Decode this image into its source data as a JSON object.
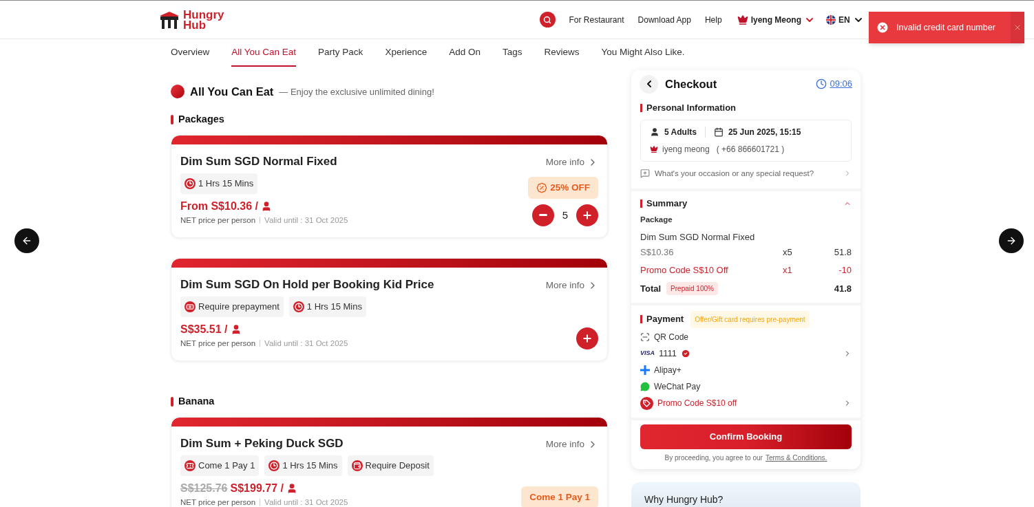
{
  "header": {
    "logo": [
      "Hungry",
      "Hub"
    ],
    "nav_links": [
      "For Restaurant",
      "Download App",
      "Help"
    ],
    "user": "Iyeng Meong",
    "language": "EN"
  },
  "toast": {
    "kind": "error",
    "message": "Invalid credit card number"
  },
  "tabs": [
    {
      "label": "Overview",
      "selected": false
    },
    {
      "label": "All You Can Eat",
      "selected": true
    },
    {
      "label": "Party Pack",
      "selected": false
    },
    {
      "label": "Xperience",
      "selected": false
    },
    {
      "label": "Add On",
      "selected": false
    },
    {
      "label": "Tags",
      "selected": false
    },
    {
      "label": "Reviews",
      "selected": false
    },
    {
      "label": "You Might Also Like.",
      "selected": false
    }
  ],
  "section": {
    "title": "All You Can Eat",
    "subtitle": "— Enjoy the exclusive unlimited dining!"
  },
  "groups": [
    {
      "title": "Packages",
      "packages": [
        {
          "name": "Dim Sum SGD Normal Fixed",
          "more_info": "More info",
          "tags": [
            {
              "kind": "duration",
              "label": "1 Hrs 15 Mins"
            }
          ],
          "price": "From S$10.36 /",
          "note": "NET price per person",
          "valid": "Valid until : 31 Oct 2025",
          "badge": {
            "kind": "discount",
            "label": "25% OFF"
          },
          "quantity": "5"
        },
        {
          "name": "Dim Sum SGD On Hold per Booking Kid Price",
          "more_info": "More info",
          "tags": [
            {
              "kind": "prepayment",
              "label": "Require prepayment"
            },
            {
              "kind": "duration",
              "label": "1 Hrs 15 Mins"
            }
          ],
          "price": "S$35.51 /",
          "note": "NET price per person",
          "valid": "Valid until : 31 Oct 2025"
        }
      ]
    },
    {
      "title": "Banana",
      "packages": [
        {
          "name": "Dim Sum + Peking Duck SGD",
          "more_info": "More info",
          "tags": [
            {
              "kind": "deal",
              "label": "Come 1 Pay 1"
            },
            {
              "kind": "duration",
              "label": "1 Hrs 15 Mins"
            },
            {
              "kind": "deposit",
              "label": "Require Deposit"
            }
          ],
          "old_price": "S$125.76",
          "price": "S$199.77 /",
          "note": "NET price per person",
          "valid": "Valid until : 31 Oct 2025",
          "badge": {
            "kind": "deal",
            "label": "Come 1 Pay 1"
          }
        }
      ]
    }
  ],
  "checkout": {
    "title": "Checkout",
    "timer": "09:06",
    "personal": {
      "title": "Personal Information",
      "guests": "5 Adults",
      "datetime": "25 Jun 2025, 15:15",
      "name": "iyeng meong",
      "phone": "( +66 866601721 )",
      "request": "What's your occasion or any special request?"
    },
    "summary": {
      "title": "Summary",
      "expanded": true,
      "package_label": "Package",
      "items": [
        {
          "kind": "package",
          "name": "Dim Sum SGD Normal Fixed",
          "price": "S$10.36",
          "qty": "x5",
          "amount": "51.8"
        },
        {
          "kind": "promo",
          "name": "Promo Code S$10 Off",
          "qty": "x1",
          "amount": "-10"
        }
      ],
      "total_label": "Total",
      "total_badge": "Prepaid 100%",
      "total": "41.8"
    },
    "payment": {
      "title": "Payment",
      "note": "Offer/Gift card requires pre-payment",
      "methods": [
        {
          "kind": "qr",
          "label": "QR Code",
          "selected": false
        },
        {
          "kind": "card",
          "brand": "VISA",
          "label": "1111",
          "selected": true
        },
        {
          "kind": "alipay",
          "label": "Alipay+",
          "selected": false
        },
        {
          "kind": "wechat",
          "label": "WeChat Pay",
          "selected": false
        },
        {
          "kind": "promo",
          "label": "Promo Code S$10 off",
          "selected": false
        }
      ]
    },
    "confirm": "Confirm Booking",
    "terms": "By proceeding, you agree to our",
    "terms_link": "Terms & Conditions."
  },
  "why_title": "Why Hungry Hub?"
}
